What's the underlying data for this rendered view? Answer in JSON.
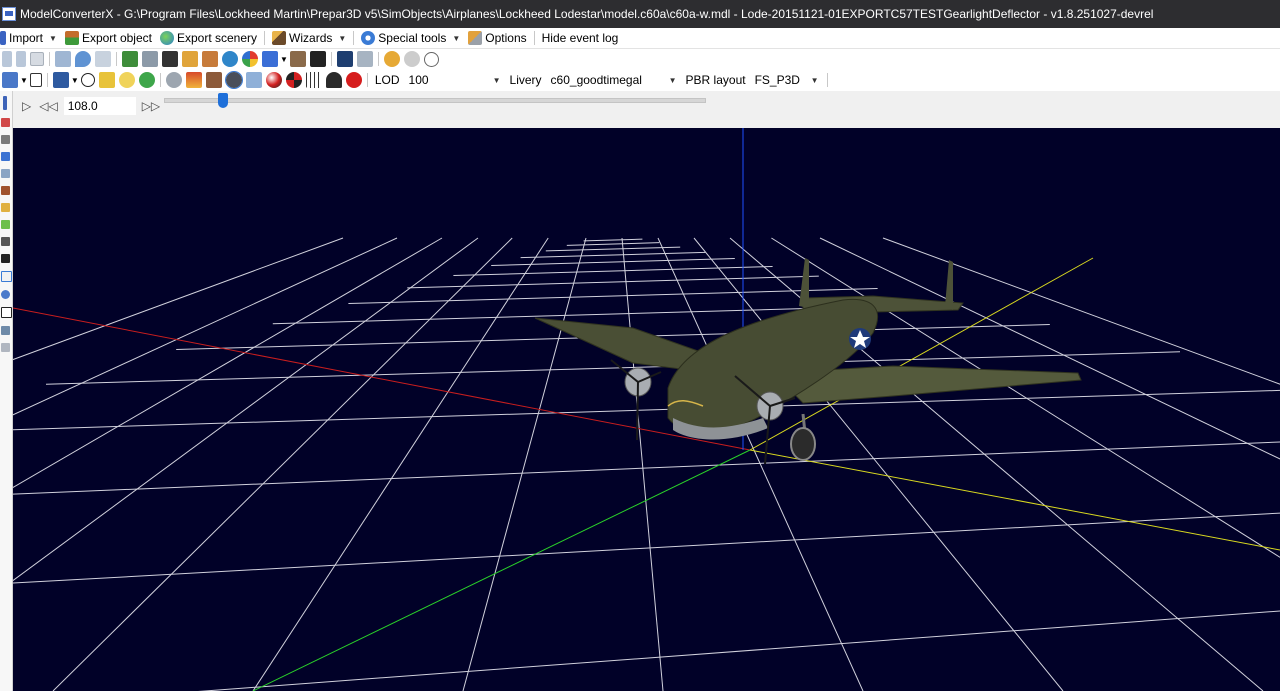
{
  "window": {
    "title": "ModelConverterX - G:\\Program Files\\Lockheed Martin\\Prepar3D v5\\SimObjects\\Airplanes\\Lockheed Lodestar\\model.c60a\\c60a-w.mdl - Lode-20151121-01EXPORTC57TESTGearlightDeflector - v1.8.251027-devrel"
  },
  "menu": {
    "import": "Import",
    "export_object": "Export object",
    "export_scenery": "Export scenery",
    "wizards": "Wizards",
    "special_tools": "Special tools",
    "options": "Options",
    "hide_event_log": "Hide event log"
  },
  "toolbar2": {
    "lod_label": "LOD",
    "lod_value": "100",
    "livery_label": "Livery",
    "livery_value": "c60_goodtimegal",
    "pbr_label": "PBR layout",
    "pbr_value": "FS_P3D"
  },
  "animation": {
    "time": "108.0",
    "slider_fraction": 0.11
  },
  "colors": {
    "viewport_bg": "#010128",
    "grid": "#e8e8f0",
    "axis_x": "#c81e1e",
    "axis_y": "#2050ff",
    "axis_z": "#2ad02a",
    "axis_alt": "#d8d820",
    "aircraft_olive": "#4a4f35"
  }
}
